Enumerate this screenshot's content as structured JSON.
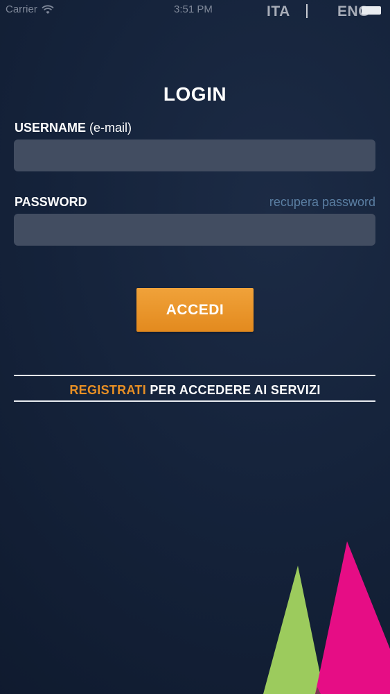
{
  "status_bar": {
    "carrier": "Carrier",
    "time": "3:51 PM"
  },
  "languages": {
    "italian": "ITA",
    "english": "ENG",
    "separator": "|"
  },
  "login": {
    "title": "LOGIN",
    "username_label": "USERNAME",
    "username_hint": "(e-mail)",
    "username_value": "",
    "password_label": "PASSWORD",
    "recover_password_label": "recupera password",
    "password_value": "",
    "submit_label": "ACCEDI"
  },
  "register": {
    "link_label": "REGISTRATI",
    "rest_label": "PER ACCEDERE AI SERVIZI"
  },
  "colors": {
    "background": "#15233b",
    "accent_orange": "#e88f24",
    "link_blue": "#5b7fa3",
    "input_background": "#424d61",
    "decoration_green": "#9ccb5d",
    "decoration_magenta": "#e60d85"
  },
  "icons": [
    "wifi-icon",
    "battery-icon"
  ]
}
